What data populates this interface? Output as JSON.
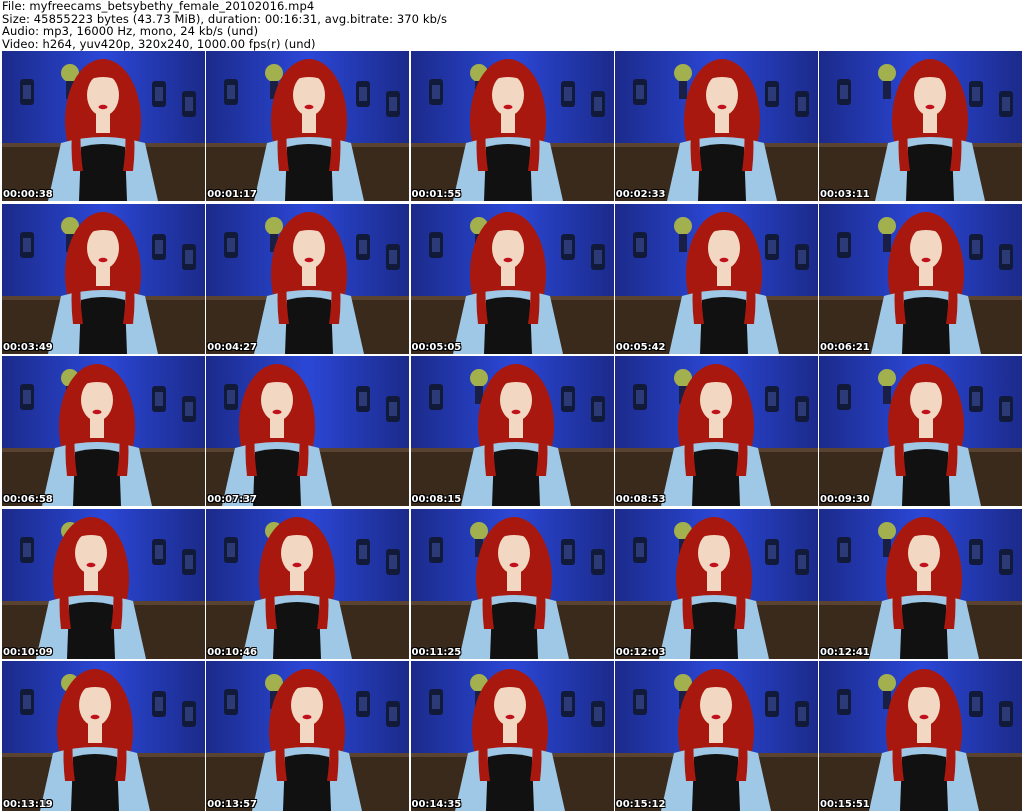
{
  "header": {
    "file_line": "File: myfreecams_betsybethy_female_20102016.mp4",
    "size_line": "Size: 45855223 bytes (43.73 MiB), duration: 00:16:31, avg.bitrate: 370 kb/s",
    "audio_line": "Audio: mp3, 16000 Hz, mono, 24 kb/s (und)",
    "video_line": "Video: h264, yuv420p, 320x240, 1000.00 fps(r) (und)"
  },
  "colors": {
    "wall": "#2b47d6",
    "wall_dark": "#1b2a8a",
    "couch": "#3a2a1c",
    "hair": "#a8180f",
    "shirt": "#9fc8e6",
    "tee": "#111111",
    "skin": "#f2d7c2"
  },
  "thumbnails": [
    {
      "time": "00:00:38"
    },
    {
      "time": "00:01:17"
    },
    {
      "time": "00:01:55"
    },
    {
      "time": "00:02:33"
    },
    {
      "time": "00:03:11"
    },
    {
      "time": "00:03:49"
    },
    {
      "time": "00:04:27"
    },
    {
      "time": "00:05:05"
    },
    {
      "time": "00:05:42"
    },
    {
      "time": "00:06:21"
    },
    {
      "time": "00:06:58"
    },
    {
      "time": "00:07:37"
    },
    {
      "time": "00:08:15"
    },
    {
      "time": "00:08:53"
    },
    {
      "time": "00:09:30"
    },
    {
      "time": "00:10:09"
    },
    {
      "time": "00:10:46"
    },
    {
      "time": "00:11:25"
    },
    {
      "time": "00:12:03"
    },
    {
      "time": "00:12:41"
    },
    {
      "time": "00:13:19"
    },
    {
      "time": "00:13:57"
    },
    {
      "time": "00:14:35"
    },
    {
      "time": "00:15:12"
    },
    {
      "time": "00:15:51"
    }
  ]
}
